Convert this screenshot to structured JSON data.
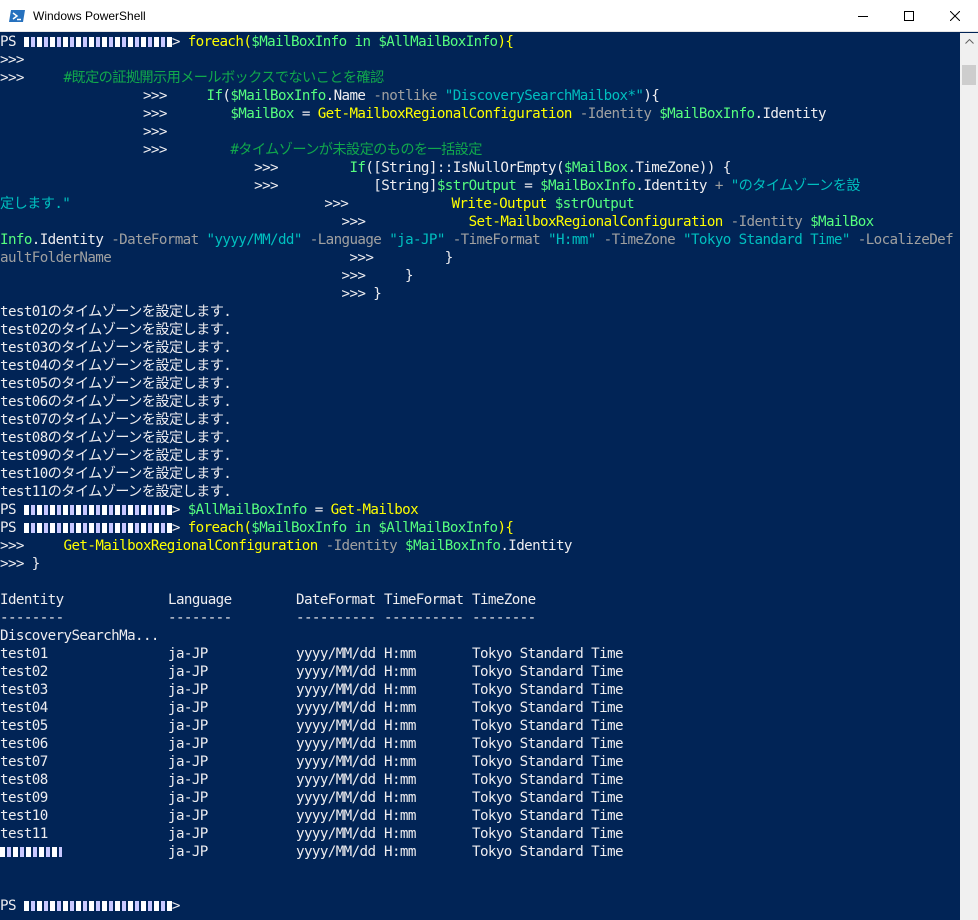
{
  "window": {
    "title": "Windows PowerShell",
    "icon": "powershell-icon",
    "controls": [
      "minimize-icon",
      "maximize-icon",
      "close-icon"
    ]
  },
  "prompt": "PS ",
  "continuation": ">>>",
  "script1": {
    "l1": {
      "kw": "foreach",
      "a": "(",
      "v1": "$MailBoxInfo",
      "in": " in ",
      "v2": "$AllMailBoxInfo",
      "b": "){"
    },
    "l3_comment": "#既定の証拠開示用メールボックスでないことを確認",
    "l4": {
      "kw": "If",
      "a": "(",
      "v": "$MailBoxInfo",
      "b": ".Name ",
      "op": "-notlike ",
      "s": "\"DiscoverySearchMailbox*\"",
      "c": "){"
    },
    "l5": {
      "v": "$MailBox",
      "eq": " = ",
      "cmd": "Get-MailboxRegionalConfiguration",
      "p": " -Identity ",
      "v2": "$MailBoxInfo",
      "r": ".Identity"
    },
    "l7_comment": "#タイムゾーンが未設定のものを一括設定",
    "l8": {
      "kw": "If",
      "a": "([String]::IsNullOrEmpty(",
      "v": "$MailBox",
      "b": ".TimeZone)) {"
    },
    "l9": {
      "a": "[String]",
      "v": "$strOutput",
      "eq": " = ",
      "v2": "$MailBoxInfo",
      "b": ".Identity ",
      "op": "+ ",
      "s": "\"のタイムゾーンを設"
    },
    "l10": {
      "s": "定します.\"",
      "cmd": "Write-Output ",
      "v": "$strOutput"
    },
    "l11": {
      "cmd": "Set-MailboxRegionalConfiguration",
      "p": " -Identity ",
      "v": "$MailBox"
    },
    "l12": {
      "v": "Info",
      "a": ".Identity ",
      "p1": "-DateFormat ",
      "s1": "\"yyyy/MM/dd\"",
      "p2": " -Language ",
      "s2": "\"ja-JP\"",
      "p3": " -TimeFormat ",
      "s3": "\"H:mm\"",
      "p4": " -TimeZone ",
      "s4": "\"Tokyo Standard Time\"",
      "p5": " -LocalizeDef"
    },
    "l13": {
      "p": "aultFolderName",
      "close": "}"
    },
    "l14": {
      "close": "}"
    },
    "l15": {
      "close": "}"
    }
  },
  "output1": [
    "test01のタイムゾーンを設定します.",
    "test02のタイムゾーンを設定します.",
    "test03のタイムゾーンを設定します.",
    "test04のタイムゾーンを設定します.",
    "test05のタイムゾーンを設定します.",
    "test06のタイムゾーンを設定します.",
    "test07のタイムゾーンを設定します.",
    "test08のタイムゾーンを設定します.",
    "test09のタイムゾーンを設定します.",
    "test10のタイムゾーンを設定します.",
    "test11のタイムゾーンを設定します."
  ],
  "cmd2": {
    "v": "$AllMailBoxInfo",
    "eq": " = ",
    "cmd": "Get-Mailbox"
  },
  "script2": {
    "l1": {
      "kw": "foreach",
      "a": "(",
      "v1": "$MailBoxInfo",
      "in": " in ",
      "v2": "$AllMailBoxInfo",
      "b": "){"
    },
    "l2": {
      "cmd": "Get-MailboxRegionalConfiguration",
      "p": " -Identity ",
      "v": "$MailBoxInfo",
      "r": ".Identity"
    },
    "l3": "}"
  },
  "table": {
    "headers": [
      "Identity",
      "Language",
      "DateFormat",
      "TimeFormat",
      "TimeZone"
    ],
    "underlines": [
      "--------",
      "--------",
      "----------",
      "----------",
      "--------"
    ],
    "rows": [
      [
        "DiscoverySearchMa...",
        "",
        "",
        "",
        ""
      ],
      [
        "test01",
        "ja-JP",
        "yyyy/MM/dd",
        "H:mm",
        "Tokyo Standard Time"
      ],
      [
        "test02",
        "ja-JP",
        "yyyy/MM/dd",
        "H:mm",
        "Tokyo Standard Time"
      ],
      [
        "test03",
        "ja-JP",
        "yyyy/MM/dd",
        "H:mm",
        "Tokyo Standard Time"
      ],
      [
        "test04",
        "ja-JP",
        "yyyy/MM/dd",
        "H:mm",
        "Tokyo Standard Time"
      ],
      [
        "test05",
        "ja-JP",
        "yyyy/MM/dd",
        "H:mm",
        "Tokyo Standard Time"
      ],
      [
        "test06",
        "ja-JP",
        "yyyy/MM/dd",
        "H:mm",
        "Tokyo Standard Time"
      ],
      [
        "test07",
        "ja-JP",
        "yyyy/MM/dd",
        "H:mm",
        "Tokyo Standard Time"
      ],
      [
        "test08",
        "ja-JP",
        "yyyy/MM/dd",
        "H:mm",
        "Tokyo Standard Time"
      ],
      [
        "test09",
        "ja-JP",
        "yyyy/MM/dd",
        "H:mm",
        "Tokyo Standard Time"
      ],
      [
        "test10",
        "ja-JP",
        "yyyy/MM/dd",
        "H:mm",
        "Tokyo Standard Time"
      ],
      [
        "test11",
        "ja-JP",
        "yyyy/MM/dd",
        "H:mm",
        "Tokyo Standard Time"
      ],
      [
        "",
        "ja-JP",
        "yyyy/MM/dd",
        "H:mm",
        "Tokyo Standard Time"
      ]
    ]
  },
  "colors": {
    "background": "#012456",
    "text": "#eeedf0",
    "command": "#ffff00",
    "variable": "#56ff7f",
    "parameter": "#a0a0a0",
    "string": "#00bfbf",
    "comment": "#11a84c"
  }
}
